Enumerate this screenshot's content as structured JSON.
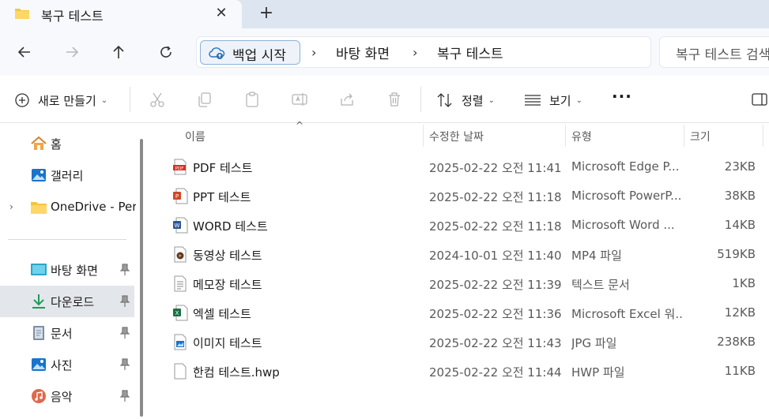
{
  "tab": {
    "title": "복구 테스트",
    "close": "✕",
    "new_tab": "+"
  },
  "nav": {
    "backup_label": "백업 시작",
    "breadcrumbs": [
      "바탕 화면",
      "복구 테스트"
    ],
    "search_placeholder": "복구 테스트 검색"
  },
  "toolbar": {
    "new_label": "새로 만들기",
    "sort_label": "정렬",
    "view_label": "보기"
  },
  "sidebar": {
    "items": [
      {
        "label": "홈",
        "icon": "home-icon"
      },
      {
        "label": "갤러리",
        "icon": "gallery-icon"
      },
      {
        "label": "OneDrive - Personal",
        "icon": "folder-icon"
      },
      {
        "label": "바탕 화면",
        "icon": "desktop-icon"
      },
      {
        "label": "다운로드",
        "icon": "download-icon"
      },
      {
        "label": "문서",
        "icon": "document-icon"
      },
      {
        "label": "사진",
        "icon": "pictures-icon"
      },
      {
        "label": "음악",
        "icon": "music-icon"
      }
    ]
  },
  "columns": {
    "name": "이름",
    "modified": "수정한 날짜",
    "type": "유형",
    "size": "크기"
  },
  "files": [
    {
      "name": "PDF 테스트",
      "modified": "2025-02-22 오전 11:41",
      "type": "Microsoft Edge P...",
      "size": "23KB",
      "icon": "pdf-file-icon"
    },
    {
      "name": "PPT 테스트",
      "modified": "2025-02-22 오전 11:18",
      "type": "Microsoft PowerP...",
      "size": "38KB",
      "icon": "ppt-file-icon"
    },
    {
      "name": "WORD 테스트",
      "modified": "2025-02-22 오전 11:18",
      "type": "Microsoft Word ...",
      "size": "14KB",
      "icon": "word-file-icon"
    },
    {
      "name": "동영상 테스트",
      "modified": "2024-10-01 오전 11:40",
      "type": "MP4 파일",
      "size": "519KB",
      "icon": "video-file-icon"
    },
    {
      "name": "메모장 테스트",
      "modified": "2025-02-22 오전 11:39",
      "type": "텍스트 문서",
      "size": "1KB",
      "icon": "text-file-icon"
    },
    {
      "name": "엑셀 테스트",
      "modified": "2025-02-22 오전 11:36",
      "type": "Microsoft Excel 워...",
      "size": "12KB",
      "icon": "excel-file-icon"
    },
    {
      "name": "이미지 테스트",
      "modified": "2025-02-22 오전 11:43",
      "type": "JPG 파일",
      "size": "238KB",
      "icon": "image-file-icon"
    },
    {
      "name": "한컴 테스트.hwp",
      "modified": "2025-02-22 오전 11:44",
      "type": "HWP 파일",
      "size": "11KB",
      "icon": "hwp-file-icon"
    }
  ]
}
